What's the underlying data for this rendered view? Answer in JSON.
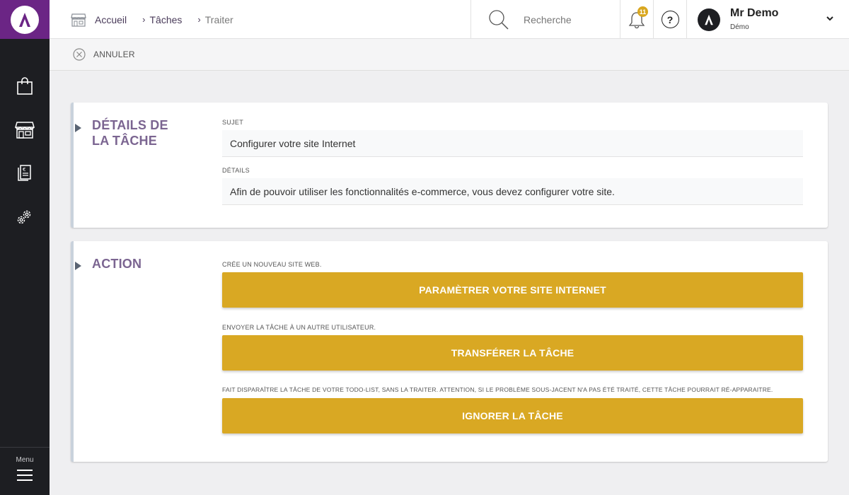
{
  "sidebar": {
    "logo": "app-logo",
    "items": [
      {
        "icon": "shopping-bag-icon"
      },
      {
        "icon": "store-icon"
      },
      {
        "icon": "invoice-icon"
      },
      {
        "icon": "settings-gears-icon"
      }
    ],
    "menu_label": "Menu"
  },
  "breadcrumb": {
    "home": "Accueil",
    "tasks": "Tâches",
    "current": "Traiter"
  },
  "search": {
    "placeholder": "Recherche"
  },
  "notifications": {
    "count": "11"
  },
  "help": {
    "label": "?"
  },
  "user": {
    "name": "Mr Demo",
    "role": "Démo"
  },
  "actionbar": {
    "cancel_label": "ANNULER"
  },
  "task_details": {
    "title_line1": "DÉTAILS DE",
    "title_line2": "LA TÂCHE",
    "subject_label": "SUJET",
    "subject_value": "Configurer votre site Internet",
    "details_label": "DÉTAILS",
    "details_value": "Afin de pouvoir utiliser les fonctionnalités e-commerce, vous devez configurer votre site."
  },
  "action": {
    "title": "ACTION",
    "items": [
      {
        "description": "CRÉE UN NOUVEAU SITE WEB.",
        "button": "PARAMÈTRER VOTRE SITE INTERNET"
      },
      {
        "description": "ENVOYER LA TÂCHE À UN AUTRE UTILISATEUR.",
        "button": "TRANSFÉRER LA TÂCHE"
      },
      {
        "description": "FAIT DISPARAÎTRE LA TÂCHE DE VOTRE TODO-LIST, SANS LA TRAITER. ATTENTION, SI LE PROBLÈME SOUS-JACENT N'A PAS ÉTÉ TRAITÉ, CETTE TÂCHE POURRAIT RÉ-APPARAITRE.",
        "button": "IGNORER LA TÂCHE"
      }
    ]
  },
  "colors": {
    "brand_purple": "#6b2585",
    "sidebar_bg": "#1d1e22",
    "accent_gold": "#d9a823",
    "title_purple": "#7b6591"
  }
}
